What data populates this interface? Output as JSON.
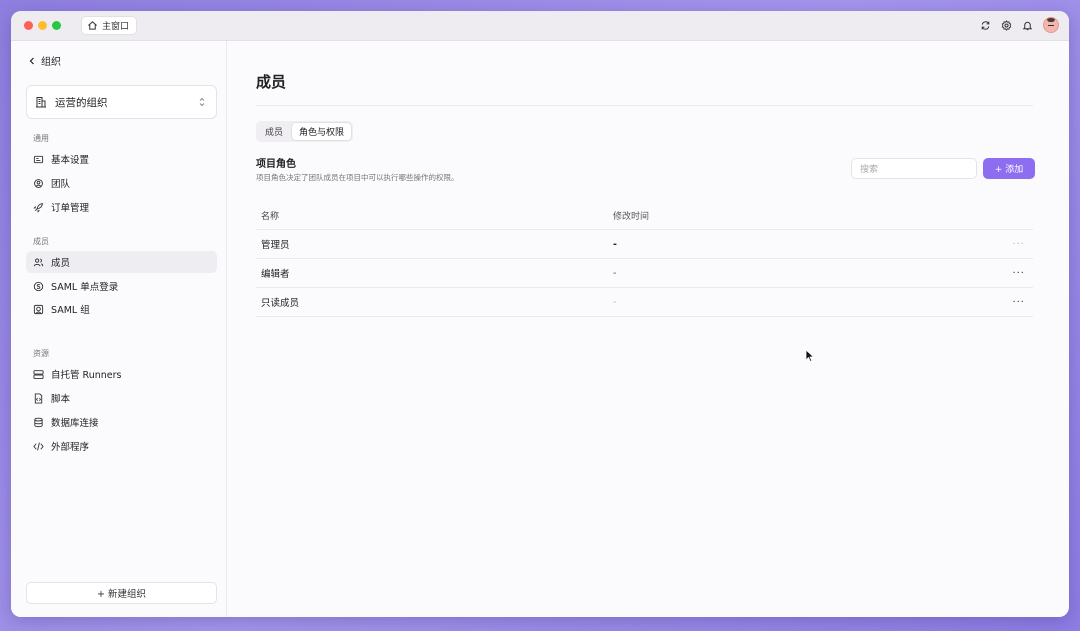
{
  "titlebar": {
    "home_tab_label": "主窗口",
    "icons": [
      "sync-icon",
      "gear-icon",
      "bell-icon",
      "avatar"
    ]
  },
  "sidebar": {
    "back_label": "组织",
    "org_name": "运营的组织",
    "sections": [
      {
        "label": "通用",
        "items": [
          {
            "label": "基本设置",
            "icon": "id-card-icon"
          },
          {
            "label": "团队",
            "icon": "team-icon"
          },
          {
            "label": "订单管理",
            "icon": "rocket-icon"
          }
        ]
      },
      {
        "label": "成员",
        "items": [
          {
            "label": "成员",
            "icon": "users-icon",
            "active": true
          },
          {
            "label": "SAML 单点登录",
            "icon": "saml-icon"
          },
          {
            "label": "SAML 组",
            "icon": "saml-group-icon"
          }
        ]
      },
      {
        "label": "资源",
        "items": [
          {
            "label": "自托管 Runners",
            "icon": "server-icon"
          },
          {
            "label": "脚本",
            "icon": "script-icon"
          },
          {
            "label": "数据库连接",
            "icon": "database-icon"
          },
          {
            "label": "外部程序",
            "icon": "code-icon"
          }
        ]
      }
    ],
    "new_org_label": "+ 新建组织"
  },
  "main": {
    "title": "成员",
    "tabs": [
      {
        "label": "成员",
        "active": false
      },
      {
        "label": "角色与权限",
        "active": true
      }
    ],
    "section_heading": "项目角色",
    "section_desc": "项目角色决定了团队成员在项目中可以执行哪些操作的权限。",
    "search_placeholder": "搜索",
    "add_label": "+ 添加",
    "table": {
      "headers": [
        "名称",
        "修改时间"
      ],
      "rows": [
        {
          "name": "管理员",
          "modified": "-",
          "more": "···"
        },
        {
          "name": "编辑者",
          "modified": "-",
          "more": "···"
        },
        {
          "name": "只读成员",
          "modified": "-",
          "more": "···"
        }
      ]
    }
  },
  "colors": {
    "accent": "#8d6df0",
    "background": "#9a8be8"
  }
}
